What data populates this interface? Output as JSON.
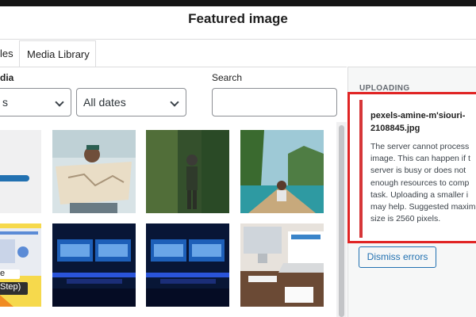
{
  "modal": {
    "title": "Featured image"
  },
  "tabs": [
    {
      "label": "les"
    },
    {
      "label": "Media Library",
      "active": true
    }
  ],
  "filters": {
    "label": "dia",
    "type_select": {
      "value": "s"
    },
    "date_select": {
      "value": "All dates"
    }
  },
  "search": {
    "label": "Search",
    "value": ""
  },
  "grid": {
    "items": [
      {
        "icon": "progress-placeholder"
      },
      {
        "icon": "woman-reading-map-photo"
      },
      {
        "icon": "hiker-in-jungle-photo"
      },
      {
        "icon": "woman-on-boat-lagoon-photo"
      },
      {
        "icon": "tutorial-step-graphic"
      },
      {
        "icon": "blue-lit-monitors-photo"
      },
      {
        "icon": "blue-lit-monitors-photo"
      },
      {
        "icon": "imac-laptop-desk-photo"
      }
    ],
    "tutorial_text_1": "e",
    "tutorial_text_2": "Step)"
  },
  "sidebar": {
    "uploading_label": "UPLOADING",
    "error": {
      "filename": "pexels-amine-m'siouri-\n2108845.jpg",
      "message_lines": [
        "The server cannot process",
        "image. This can happen if t",
        "server is busy or does not",
        "enough resources to comp",
        "task. Uploading a smaller i",
        "may help. Suggested maxim",
        "size is 2560 pixels."
      ]
    },
    "dismiss_label": "Dismiss errors"
  },
  "colors": {
    "accent": "#2271b1",
    "error": "#d63638",
    "highlight": "#e02424"
  }
}
